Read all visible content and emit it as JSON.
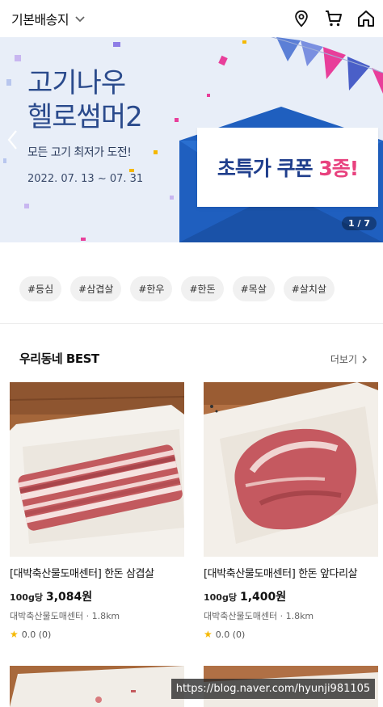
{
  "header": {
    "address_label": "기본배송지"
  },
  "icons": {
    "location": "location-pin-icon",
    "cart": "cart-icon",
    "home": "home-icon"
  },
  "banner": {
    "title_line1": "고기나우",
    "title_line2": "헬로썸머2",
    "subtitle": "모든 고기 최저가 도전!",
    "date": "2022. 07. 13 ~ 07. 31",
    "coupon_main": "초특가 쿠폰 ",
    "coupon_accent": "3종!",
    "page_indicator": "1 / 7"
  },
  "tags": [
    "#등심",
    "#삼겹살",
    "#한우",
    "#한돈",
    "#목살",
    "#살치살"
  ],
  "section": {
    "title": "우리동네 BEST",
    "more_label": "더보기"
  },
  "products": [
    {
      "name": "[대박축산물도매센터] 한돈 삼겹살",
      "unit": "100g당",
      "price": "3,084원",
      "store": "대박축산물도매센터 · 1.8km",
      "rating": "0.0 (0)"
    },
    {
      "name": "[대박축산물도매센터] 한돈 앞다리살",
      "unit": "100g당",
      "price": "1,400원",
      "store": "대박축산물도매센터 · 1.8km",
      "rating": "0.0 (0)"
    }
  ],
  "watermark": "https://blog.naver.com/hyunji981105",
  "colors": {
    "banner_bg": "#e8eef8",
    "banner_title": "#2a4a8c",
    "coupon_blue": "#1f3e8c",
    "coupon_pink": "#e8417e",
    "envelope": "#1f5fbf",
    "star": "#f5b800"
  }
}
